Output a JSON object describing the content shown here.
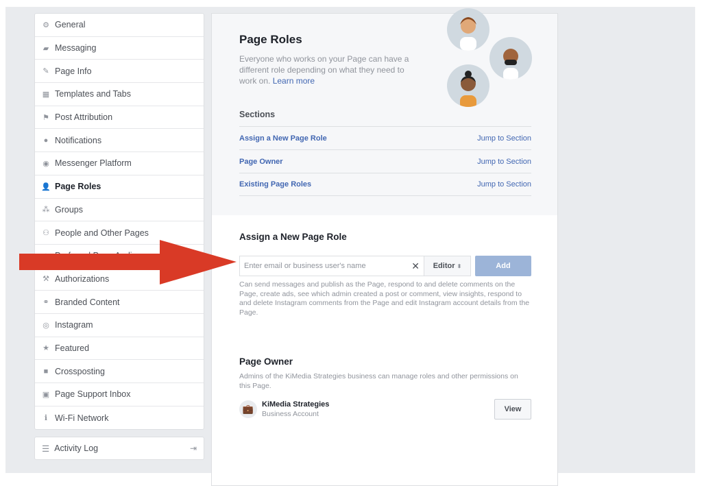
{
  "sidebar": {
    "items": [
      {
        "label": "General",
        "icon": "gear-icon",
        "glyph": "⚙"
      },
      {
        "label": "Messaging",
        "icon": "messaging-icon",
        "glyph": "▰"
      },
      {
        "label": "Page Info",
        "icon": "pencil-icon",
        "glyph": "✎"
      },
      {
        "label": "Templates and Tabs",
        "icon": "grid-icon",
        "glyph": "▦"
      },
      {
        "label": "Post Attribution",
        "icon": "flag-icon",
        "glyph": "⚑"
      },
      {
        "label": "Notifications",
        "icon": "globe-icon",
        "glyph": "●"
      },
      {
        "label": "Messenger Platform",
        "icon": "messenger-icon",
        "glyph": "◉"
      },
      {
        "label": "Page Roles",
        "icon": "person-icon",
        "glyph": "👤",
        "active": true
      },
      {
        "label": "Groups",
        "icon": "groups-icon",
        "glyph": "⁂"
      },
      {
        "label": "People and Other Pages",
        "icon": "person-star-icon",
        "glyph": "⚇"
      },
      {
        "label": "Preferred Page Audience",
        "icon": "audience-icon",
        "glyph": "✦"
      },
      {
        "label": "Authorizations",
        "icon": "wrench-icon",
        "glyph": "⚒"
      },
      {
        "label": "Branded Content",
        "icon": "handshake-icon",
        "glyph": "⚭"
      },
      {
        "label": "Instagram",
        "icon": "instagram-icon",
        "glyph": "◎"
      },
      {
        "label": "Featured",
        "icon": "star-icon",
        "glyph": "★"
      },
      {
        "label": "Crossposting",
        "icon": "video-icon",
        "glyph": "■"
      },
      {
        "label": "Page Support Inbox",
        "icon": "inbox-icon",
        "glyph": "▣"
      },
      {
        "label": "Wi-Fi Network",
        "icon": "info-icon",
        "glyph": "ℹ"
      }
    ],
    "activity_log": "Activity Log"
  },
  "page_roles": {
    "title": "Page Roles",
    "intro": "Everyone who works on your Page can have a different role depending on what they need to work on.",
    "learn_more": "Learn more"
  },
  "sections": {
    "title": "Sections",
    "rows": [
      {
        "name": "Assign a New Page Role",
        "jump": "Jump to Section"
      },
      {
        "name": "Page Owner",
        "jump": "Jump to Section"
      },
      {
        "name": "Existing Page Roles",
        "jump": "Jump to Section"
      }
    ]
  },
  "assign": {
    "title": "Assign a New Page Role",
    "placeholder": "Enter email or business user's name",
    "role": "Editor",
    "add": "Add",
    "description": "Can send messages and publish as the Page, respond to and delete comments on the Page, create ads, see which admin created a post or comment, view insights, respond to and delete Instagram comments from the Page and edit Instagram account details from the Page."
  },
  "owner": {
    "title": "Page Owner",
    "description": "Admins of the KiMedia Strategies business can manage roles and other permissions on this Page.",
    "business_name": "KiMedia Strategies",
    "business_type": "Business Account",
    "view": "View"
  },
  "colors": {
    "link": "#4267b2",
    "add_button": "#9cb4d8",
    "arrow": "#d93a26",
    "background": "#e9ebee"
  }
}
